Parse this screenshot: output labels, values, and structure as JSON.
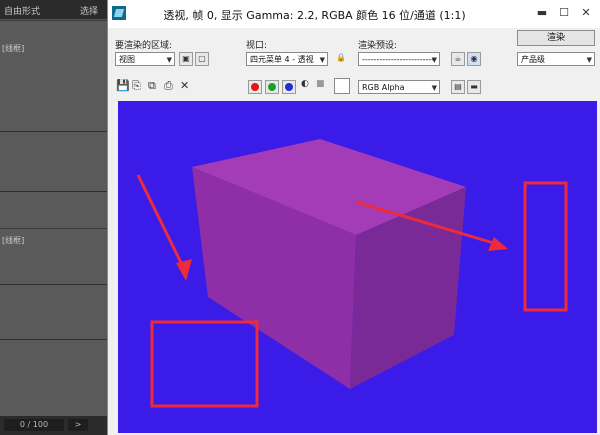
{
  "background_app": {
    "top_left_label": "自由形式",
    "top_right_label": "选择",
    "pane1_label": "[线框]",
    "pane2_label": "[线框]",
    "frame_counter": "0 / 100",
    "next_arrow": ">"
  },
  "render_window": {
    "title": "透视, 帧 0, 显示 Gamma: 2.2, RGBA 颜色 16 位/通道 (1:1)",
    "window_buttons": {
      "minimize": "▬",
      "maximize": "☐",
      "close": "✕"
    },
    "area_label": "要渲染的区域:",
    "area_value": "视图",
    "viewport_label": "视口:",
    "viewport_value": "四元菜单 4 - 透视",
    "preset_label": "渲染预设:",
    "preset_value": "-------------------------",
    "render_button": "渲染",
    "production_value": "产品级",
    "channel_value": "RGB Alpha",
    "color_swatch": "#ffffff"
  },
  "colors": {
    "viewport_bg": "#3b1be8",
    "box_front": "#8e2fa8",
    "box_top": "#a43cb8",
    "box_side": "#7a2a96",
    "annotation": "#ee2b3b",
    "red_channel": "#e0161b",
    "green_channel": "#17a12b",
    "blue_channel": "#1b2fd6"
  },
  "icons": [
    "save-icon",
    "copy-icon",
    "clone-icon",
    "print-icon",
    "clear-icon",
    "lock-icon",
    "teapot-icon",
    "environment-icon",
    "mono-icon",
    "alpha-icon"
  ]
}
